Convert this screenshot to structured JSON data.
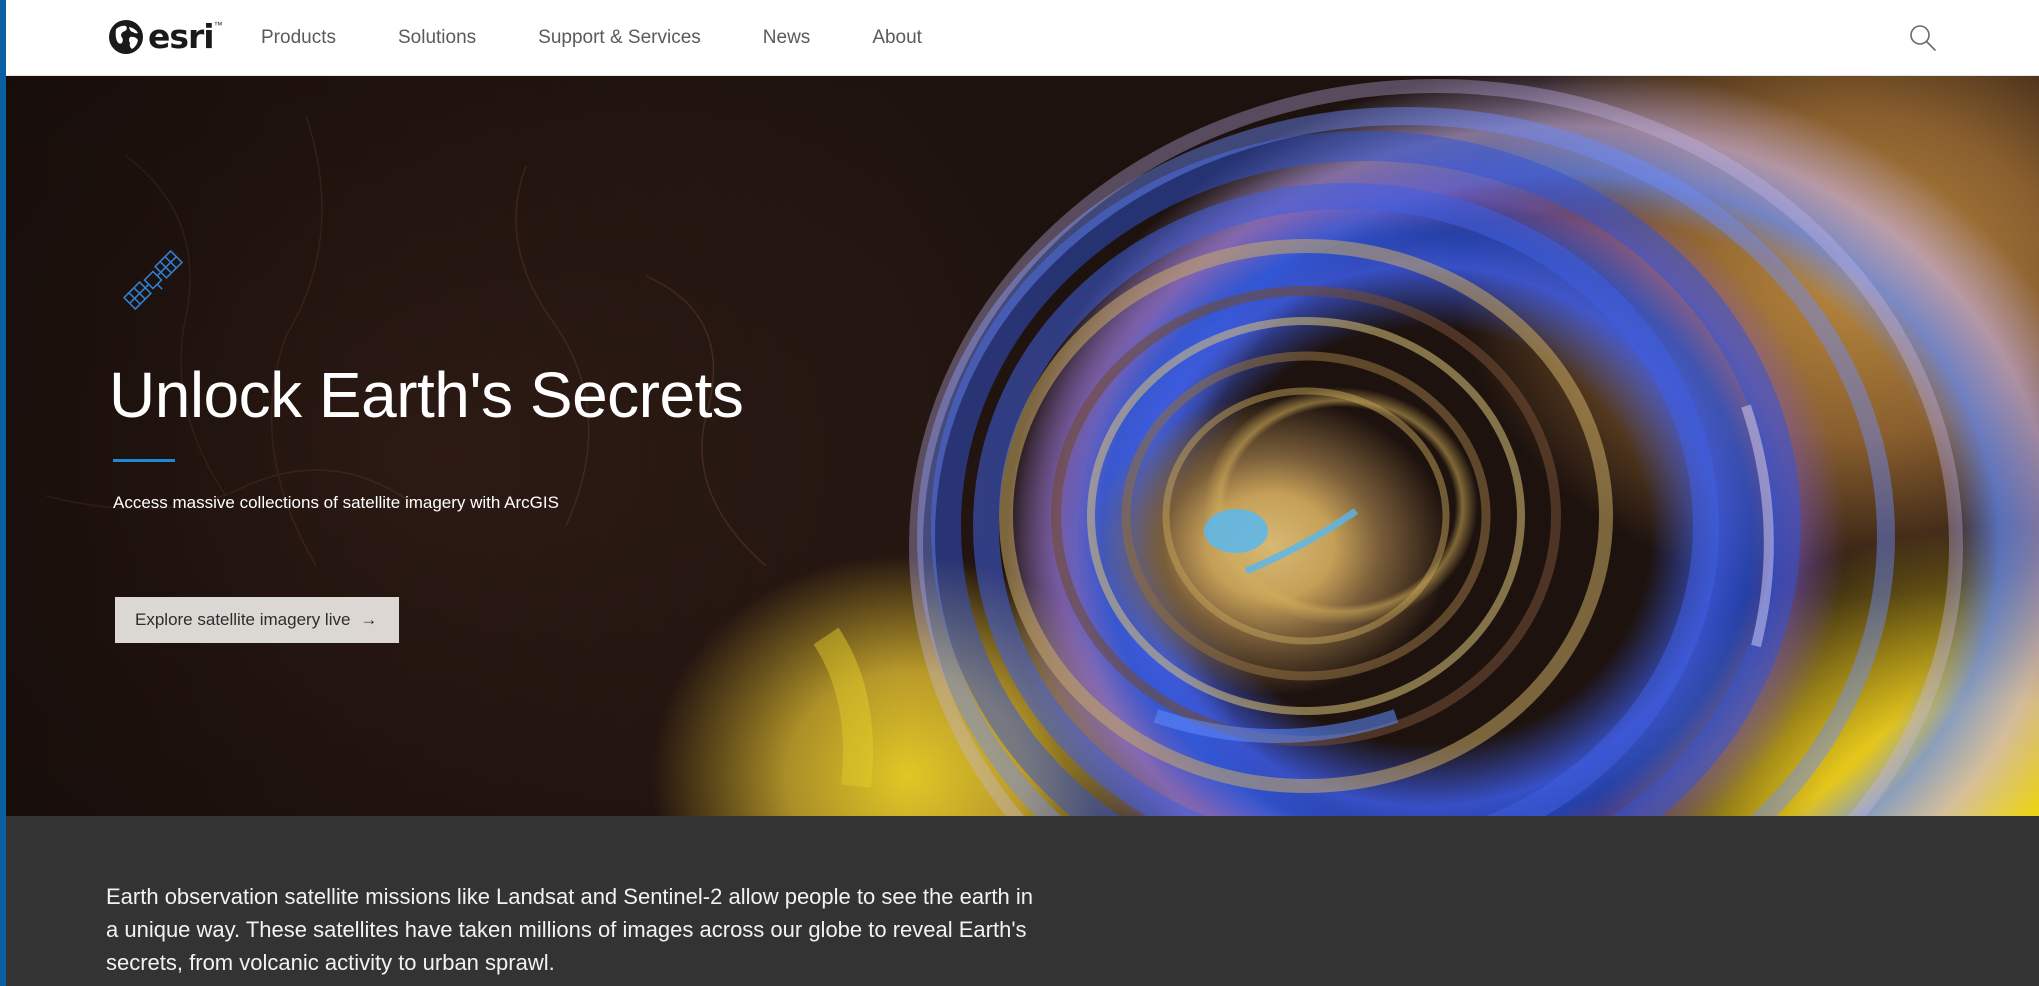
{
  "header": {
    "logo_text": "esri",
    "logo_tm": "™",
    "nav": [
      {
        "label": "Products"
      },
      {
        "label": "Solutions"
      },
      {
        "label": "Support & Services"
      },
      {
        "label": "News"
      },
      {
        "label": "About"
      }
    ],
    "search_icon": "search-icon"
  },
  "hero": {
    "icon": "satellite-icon",
    "title": "Unlock Earth's Secrets",
    "subtitle": "Access massive collections of satellite imagery with ArcGIS",
    "cta_label": "Explore satellite imagery live",
    "cta_arrow": "→",
    "accent_color": "#1e8ad6"
  },
  "intro": {
    "text": "Earth observation satellite missions like Landsat and Sentinel-2 allow people to see the earth in a unique way. These satellites have taken millions of images across our globe to reveal Earth's secrets, from volcanic activity to urban sprawl."
  },
  "colors": {
    "window_border": "#0a5fa3",
    "intro_background": "#333333",
    "nav_text": "#5a5a5a"
  }
}
